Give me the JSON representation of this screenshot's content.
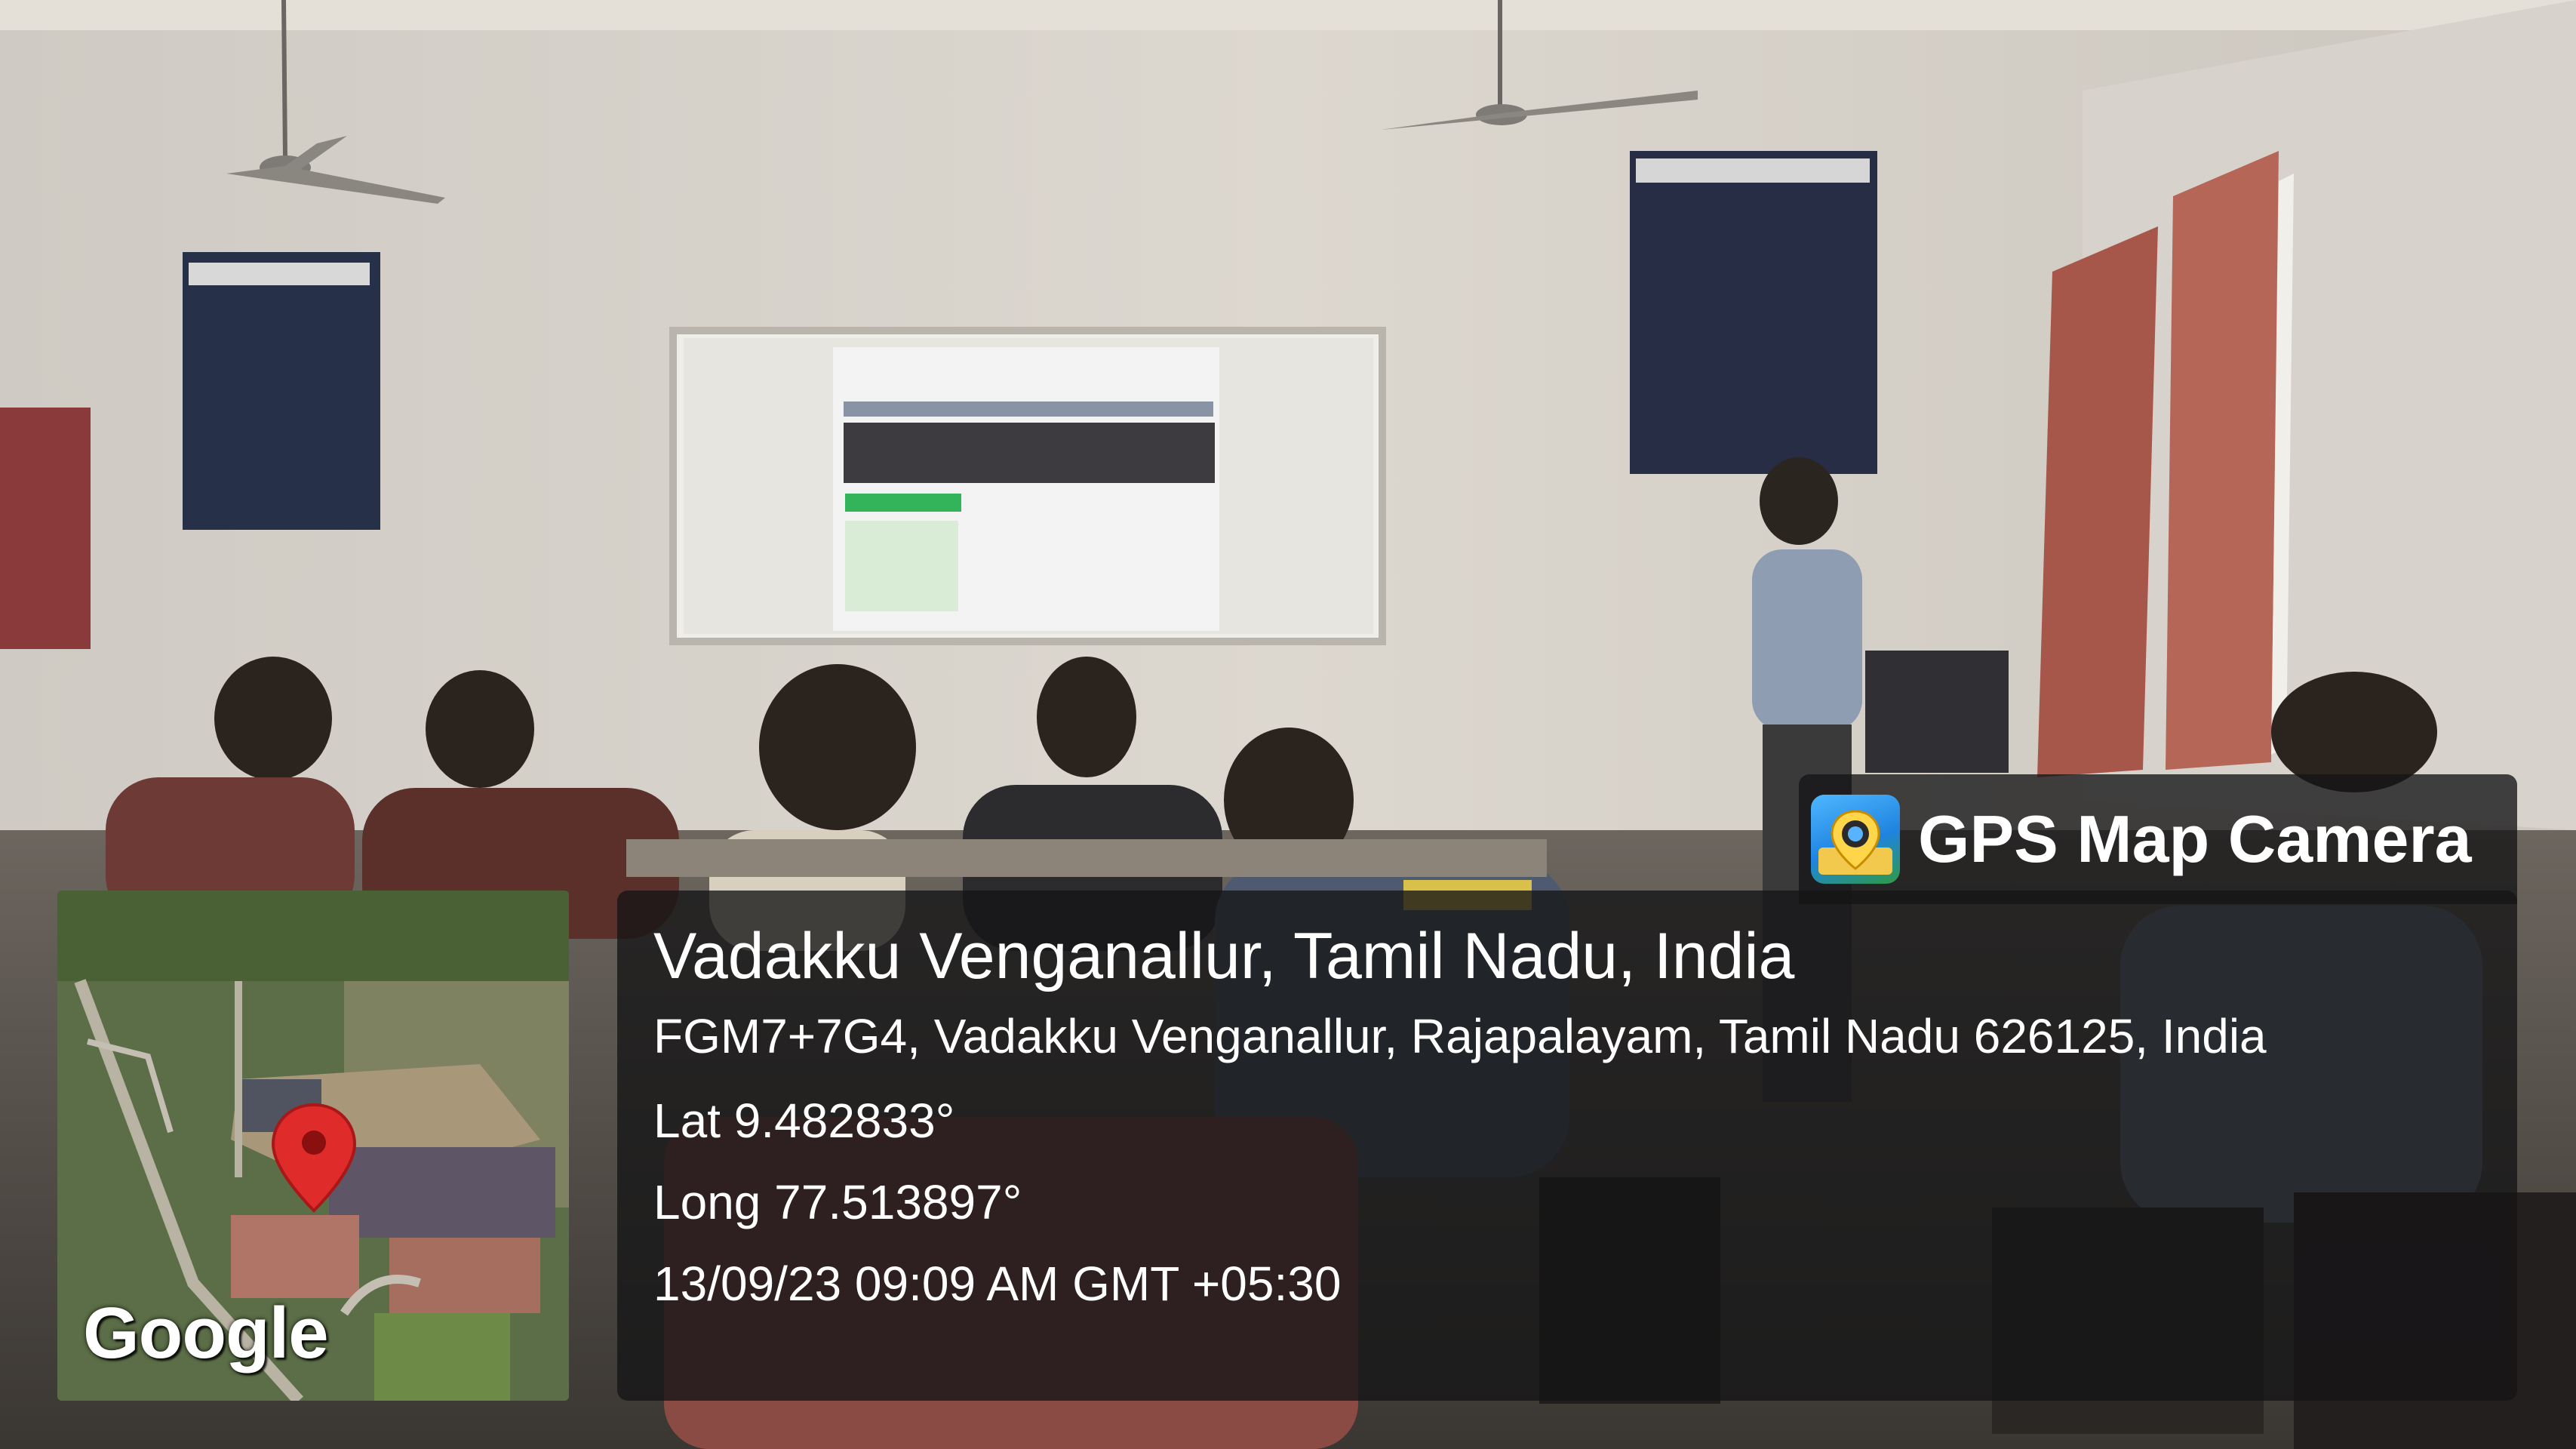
{
  "overlay": {
    "app_name": "GPS Map Camera",
    "place_title": "Vadakku Venganallur, Tamil Nadu, India",
    "address": "FGM7+7G4, Vadakku Venganallur, Rajapalayam, Tamil Nadu 626125, India",
    "latitude": "Lat 9.482833°",
    "longitude": "Long 77.513897°",
    "datetime": "13/09/23 09:09 AM GMT +05:30",
    "map_brand": "Google"
  },
  "icons": {
    "app_icon": "gps-camera-icon",
    "map_pin": "location-pin-icon"
  },
  "colors": {
    "overlay_bg": "#141416",
    "text": "#ffffff",
    "pin": "#e02b2b"
  }
}
